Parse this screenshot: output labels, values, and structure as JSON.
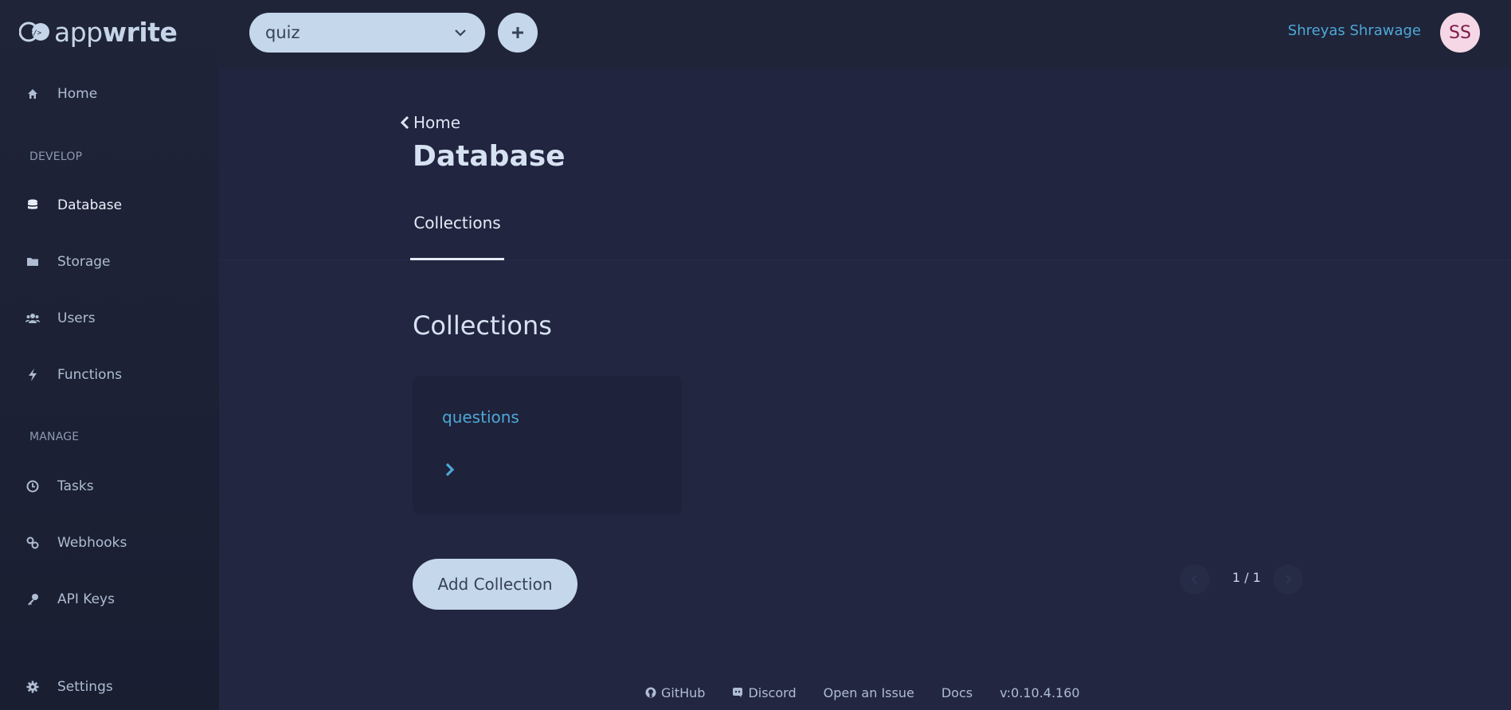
{
  "app": {
    "logo_light": "app",
    "logo_bold": "write"
  },
  "sidebar": {
    "items_top": [
      {
        "label": "Home",
        "icon": "home-icon"
      }
    ],
    "develop_label": "DEVELOP",
    "develop": [
      {
        "label": "Database",
        "icon": "database-icon",
        "active": true
      },
      {
        "label": "Storage",
        "icon": "folder-icon"
      },
      {
        "label": "Users",
        "icon": "users-icon"
      },
      {
        "label": "Functions",
        "icon": "bolt-icon"
      }
    ],
    "manage_label": "MANAGE",
    "manage": [
      {
        "label": "Tasks",
        "icon": "clock-icon"
      },
      {
        "label": "Webhooks",
        "icon": "link-icon"
      },
      {
        "label": "API Keys",
        "icon": "key-icon"
      }
    ],
    "settings": {
      "label": "Settings",
      "icon": "gear-icon"
    }
  },
  "topbar": {
    "project_value": "quiz",
    "user_name": "Shreyas Shrawage",
    "avatar_initials": "SS"
  },
  "header": {
    "back_label": "Home",
    "title": "Database",
    "tab_label": "Collections"
  },
  "main": {
    "section_title": "Collections",
    "collections": [
      {
        "name": "questions"
      }
    ],
    "add_button": "Add Collection",
    "pager_text": "1 / 1"
  },
  "footer": {
    "github": "GitHub",
    "discord": "Discord",
    "issue": "Open an Issue",
    "docs": "Docs",
    "version": "v:0.10.4.160"
  },
  "colors": {
    "background": "#222640",
    "sidebar": "#1f2439",
    "accent": "#4ea8d6",
    "button": "#c5d7ea",
    "avatar_bg": "#f5d7e6"
  }
}
